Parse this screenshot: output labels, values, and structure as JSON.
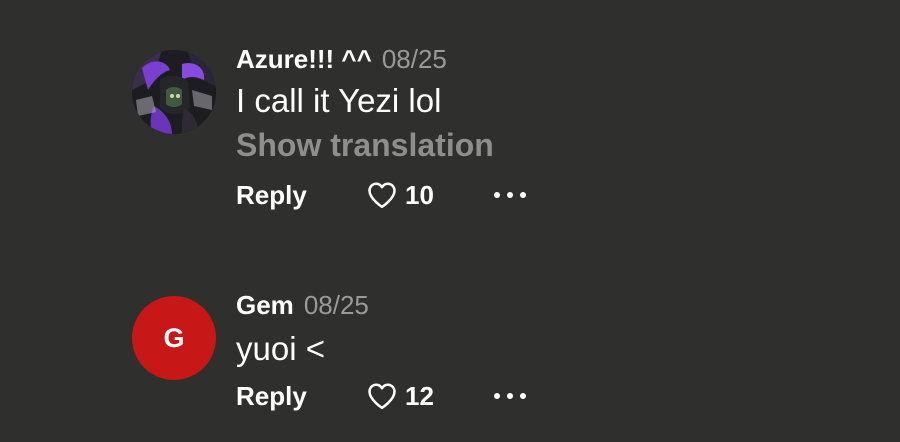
{
  "comments": [
    {
      "username": "Azure!!! ^^",
      "date": "08/25",
      "text": "I call it Yezi lol",
      "translation_label": "Show translation",
      "reply_label": "Reply",
      "likes": "10"
    },
    {
      "avatar_letter": "G",
      "username": "Gem",
      "date": "08/25",
      "text": "yuoi <",
      "reply_label": "Reply",
      "likes": "12"
    }
  ],
  "colors": {
    "background": "#2f2f2d",
    "secondary_text": "#9a9a98",
    "avatar_red": "#c81717"
  },
  "icons": [
    "heart-icon",
    "more-options-icon"
  ]
}
